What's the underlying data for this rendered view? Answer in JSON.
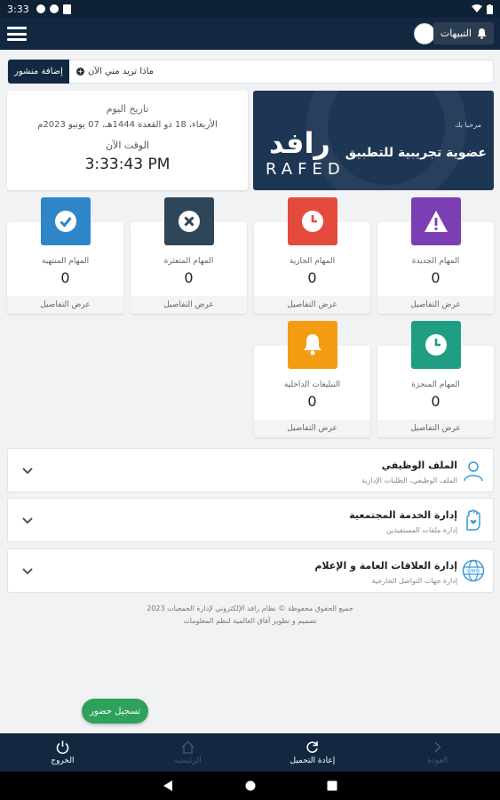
{
  "status_bar": {
    "time": "3:33"
  },
  "header": {
    "notifications_label": "التبيهات"
  },
  "post_bar": {
    "button_label": "إضافة منشور",
    "placeholder": "ماذا تريد مني الآن"
  },
  "date_card": {
    "date_label": "تاريخ اليوم",
    "date_value": "الأربعاء، 18 ذو القعدة 1444هـ، 07 يونيو 2023م",
    "time_label": "الوقت الآن",
    "time_value": "3:33:43 PM"
  },
  "banner": {
    "greeting": "مرحبا بك",
    "subtitle": "عضوية تجريبية للتطبيق",
    "logo_ar": "رافد",
    "logo_en": "RAFED"
  },
  "stats": [
    {
      "title": "المهام الجديدة",
      "count": "0",
      "footer": "عرض التفاصيل",
      "color": "#7b3fb3",
      "icon": "warning-icon"
    },
    {
      "title": "المهام الجارية",
      "count": "0",
      "footer": "عرض التفاصيل",
      "color": "#e54b3c",
      "icon": "clock-icon"
    },
    {
      "title": "المهام المتعثرة",
      "count": "0",
      "footer": "عرض التفاصيل",
      "color": "#2f4659",
      "icon": "close-circle-icon"
    },
    {
      "title": "المهام المنتهية",
      "count": "0",
      "footer": "عرض التفاصيل",
      "color": "#2e86c9",
      "icon": "check-circle-icon"
    },
    {
      "title": "المهام المنجزة",
      "count": "0",
      "footer": "عرض التفاصيل",
      "color": "#1f9e84",
      "icon": "clock-icon"
    },
    {
      "title": "التبليغات الداخلية",
      "count": "0",
      "footer": "عرض التفاصيل",
      "color": "#f39c12",
      "icon": "bell-icon"
    }
  ],
  "accordions": [
    {
      "title": "الملف الوظيفي",
      "subtitle": "الملف الوظيفي، الطلبات الإدارية",
      "icon": "user-profile-icon"
    },
    {
      "title": "إدارة الخدمة المجتمعية",
      "subtitle": "إدارة ملفات المستفيدين",
      "icon": "hand-heart-icon"
    },
    {
      "title": "إدارة العلاقات العامة و الإعلام",
      "subtitle": "إدارة جهات التواصل الخارجية",
      "icon": "globe-www-icon"
    }
  ],
  "footer": {
    "copyright": "جميع الحقوق محفوظة © نظام رافد الإلكتروني لإدارة الجمعيات 2023",
    "credit": "تصميم و تطوير آفاق العالمية لنظم المعلومات"
  },
  "checkin_label": "تسجيل حضور",
  "bottom_nav": [
    {
      "label": "الخروج",
      "icon": "power-icon"
    },
    {
      "label": "الرئيسية",
      "icon": "home-icon"
    },
    {
      "label": "إعادة التحميل",
      "icon": "refresh-icon"
    },
    {
      "label": "العودة",
      "icon": "chevron-right-icon"
    }
  ],
  "colors": {
    "navy": "#132840",
    "green": "#2ea25a"
  }
}
